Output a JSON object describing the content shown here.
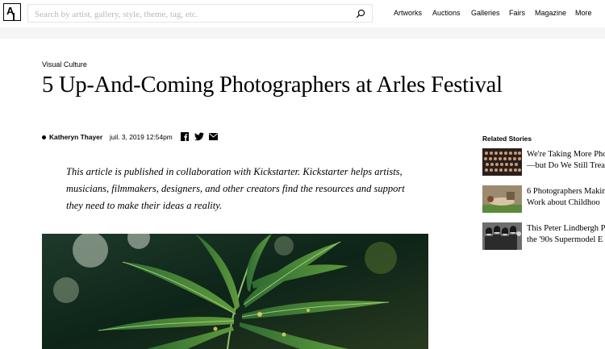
{
  "header": {
    "logo_text": "A",
    "search_placeholder": "Search by artist, gallery, style, theme, tag, etc.",
    "nav": [
      "Artworks",
      "Auctions",
      "Galleries",
      "Fairs",
      "Magazine",
      "More"
    ]
  },
  "article": {
    "category": "Visual Culture",
    "title": "5 Up-And-Coming Photographers at Arles Festival",
    "author": "Katheryn Thayer",
    "date": "juil. 3, 2019 12:54pm",
    "intro": "This article is published in collaboration with Kickstarter. Kickstarter helps artists, musicians, filmmakers, designers, and other creators find the resources and support they need to make their ideas a reality.",
    "share_icons": [
      "facebook-icon",
      "twitter-icon",
      "email-icon"
    ]
  },
  "related": {
    "heading": "Related Stories",
    "items": [
      {
        "line1": "We're Taking More Pho",
        "line2": "—but Do We Still Trea"
      },
      {
        "line1": "6 Photographers Makin",
        "line2": "Work about Childhoo"
      },
      {
        "line1": "This Peter Lindbergh P",
        "line2": "the '90s Supermodel E"
      }
    ]
  },
  "colors": {
    "background": "#ffffff",
    "text": "#000000",
    "search_border": "#e5e5e5",
    "placeholder": "#b8b8b8",
    "band": "#f5f5f5"
  }
}
